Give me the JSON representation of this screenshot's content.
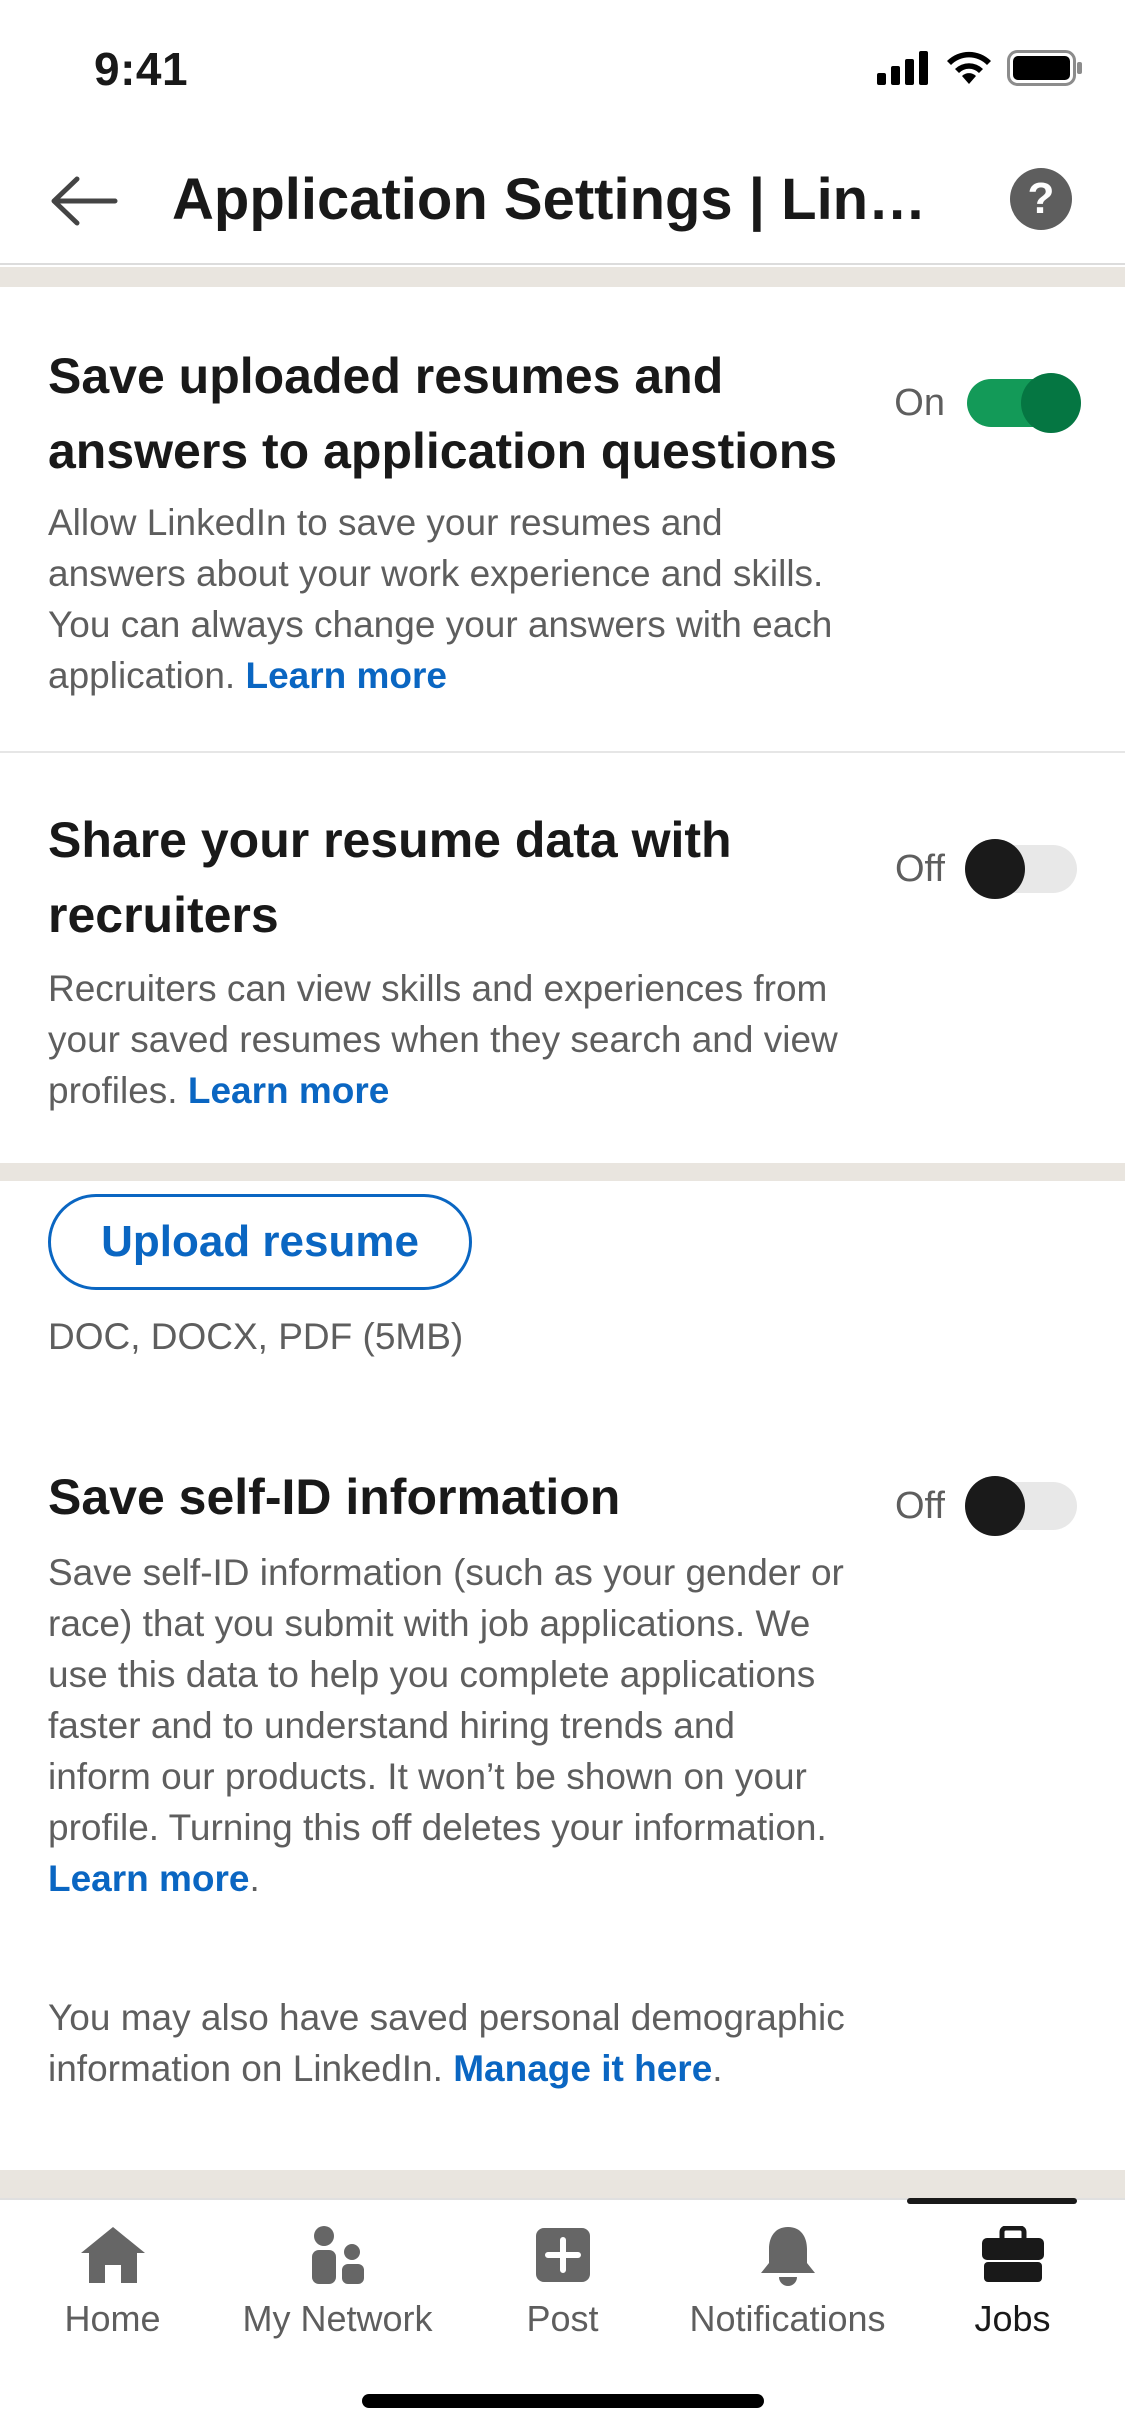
{
  "status_bar": {
    "time": "9:41"
  },
  "header": {
    "title": "Application Settings | LinkedIn",
    "help_label": "?"
  },
  "settings": {
    "save_resumes": {
      "title": "Save uploaded resumes and answers to application questions",
      "description": "Allow LinkedIn to save your resumes and answers about your work experience and skills. You can always change your answers with each application.",
      "link": "Learn more",
      "toggle_label": "On",
      "enabled": true
    },
    "share_resume": {
      "title": "Share your resume data with recruiters",
      "description": "Recruiters can view skills and experiences from your saved resumes when they search and view profiles.",
      "link": "Learn more",
      "toggle_label": "Off",
      "enabled": false
    },
    "self_id": {
      "title": "Save self-ID information",
      "description": "Save self-ID information (such as your gender or race) that you submit with job applications. We use this data to help you complete applications faster and to understand hiring trends and inform our products. It won’t be shown on your profile. Turning this off deletes your information.",
      "link": "Learn more",
      "link_suffix": ".",
      "extra_description": "You may also have saved personal demographic information on LinkedIn.",
      "extra_link": "Manage it here",
      "extra_suffix": ".",
      "toggle_label": "Off",
      "enabled": false
    }
  },
  "upload": {
    "button_label": "Upload resume",
    "hint": "DOC, DOCX, PDF (5MB)"
  },
  "bottom_nav": {
    "items": [
      {
        "label": "Home",
        "icon": "home-icon"
      },
      {
        "label": "My Network",
        "icon": "network-icon"
      },
      {
        "label": "Post",
        "icon": "post-icon"
      },
      {
        "label": "Notifications",
        "icon": "bell-icon"
      },
      {
        "label": "Jobs",
        "icon": "briefcase-icon",
        "active": true
      }
    ]
  },
  "colors": {
    "accent": "#0a66c2",
    "toggle_on": "#139a58",
    "toggle_knob_on": "#057642",
    "section_gap": "#e9e5df",
    "muted_text": "#5e5e5e"
  }
}
